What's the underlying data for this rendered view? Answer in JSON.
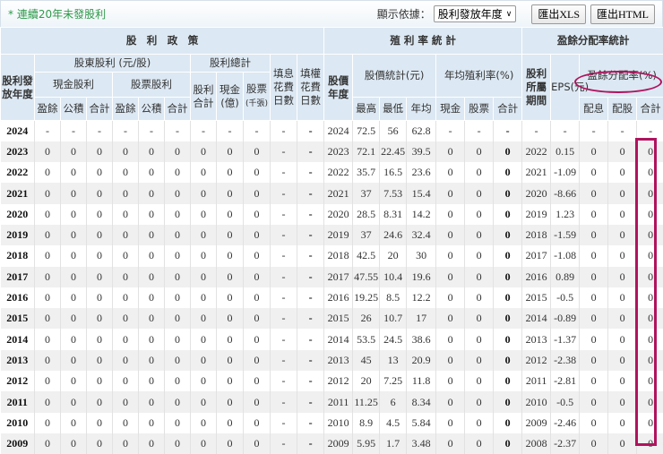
{
  "topbar": {
    "note": "* 連續20年未發股利",
    "display_label": "顯示依據：",
    "display_value": "股利發放年度",
    "export_xls": "匯出XLS",
    "export_html": "匯出HTML"
  },
  "headers": {
    "policy": "股　利　政　策",
    "yield_stats": "殖 利 率 統 計",
    "payout_stats": "盈餘分配率統計",
    "div_year": "股利發放年度",
    "shareholder_div": "股東股利 (元/股)",
    "div_total": "股利總計",
    "fill_div": "填息花費日數",
    "fill_right": "填權花費日數",
    "cash_div": "現金股利",
    "stock_div": "股票股利",
    "earn": "盈餘",
    "reserve": "公積",
    "sum": "合計",
    "div_sum": "股利合計",
    "cash_100m": "現金(億)",
    "stock_k": "股票",
    "stock_k_unit": "(千張)",
    "price_year": "股價年度",
    "price_stats": "股價統計(元)",
    "avg_yield": "年均殖利率(%)",
    "high": "最高",
    "low": "最低",
    "avg": "年均",
    "cash": "現金",
    "stock": "股票",
    "period": "股利所屬期間",
    "eps": "EPS(元)",
    "payout": "盈餘分配率(%)",
    "p_cash": "配息",
    "p_stock": "配股"
  },
  "rows": [
    [
      "2024",
      "-",
      "-",
      "-",
      "-",
      "-",
      "-",
      "-",
      "-",
      "-",
      "-",
      "-",
      "2024",
      "72.5",
      "56",
      "62.8",
      "-",
      "-",
      "-",
      "-",
      "-",
      "-",
      "-",
      "-"
    ],
    [
      "2023",
      "0",
      "0",
      "0",
      "0",
      "0",
      "0",
      "0",
      "0",
      "0",
      "-",
      "-",
      "2023",
      "72.1",
      "22.45",
      "39.5",
      "0",
      "0",
      "0",
      "2022",
      "0.15",
      "0",
      "0",
      "0"
    ],
    [
      "2022",
      "0",
      "0",
      "0",
      "0",
      "0",
      "0",
      "0",
      "0",
      "0",
      "-",
      "-",
      "2022",
      "35.7",
      "16.5",
      "23.6",
      "0",
      "0",
      "0",
      "2021",
      "-1.09",
      "0",
      "0",
      "0"
    ],
    [
      "2021",
      "0",
      "0",
      "0",
      "0",
      "0",
      "0",
      "0",
      "0",
      "0",
      "-",
      "-",
      "2021",
      "37",
      "7.53",
      "15.4",
      "0",
      "0",
      "0",
      "2020",
      "-8.66",
      "0",
      "0",
      "0"
    ],
    [
      "2020",
      "0",
      "0",
      "0",
      "0",
      "0",
      "0",
      "0",
      "0",
      "0",
      "-",
      "-",
      "2020",
      "28.5",
      "8.31",
      "14.2",
      "0",
      "0",
      "0",
      "2019",
      "1.23",
      "0",
      "0",
      "0"
    ],
    [
      "2019",
      "0",
      "0",
      "0",
      "0",
      "0",
      "0",
      "0",
      "0",
      "0",
      "-",
      "-",
      "2019",
      "37",
      "24.6",
      "32.4",
      "0",
      "0",
      "0",
      "2018",
      "-1.59",
      "0",
      "0",
      "0"
    ],
    [
      "2018",
      "0",
      "0",
      "0",
      "0",
      "0",
      "0",
      "0",
      "0",
      "0",
      "-",
      "-",
      "2018",
      "42.5",
      "20",
      "30",
      "0",
      "0",
      "0",
      "2017",
      "-1.08",
      "0",
      "0",
      "0"
    ],
    [
      "2017",
      "0",
      "0",
      "0",
      "0",
      "0",
      "0",
      "0",
      "0",
      "0",
      "-",
      "-",
      "2017",
      "47.55",
      "10.4",
      "19.6",
      "0",
      "0",
      "0",
      "2016",
      "0.89",
      "0",
      "0",
      "0"
    ],
    [
      "2016",
      "0",
      "0",
      "0",
      "0",
      "0",
      "0",
      "0",
      "0",
      "0",
      "-",
      "-",
      "2016",
      "19.25",
      "8.5",
      "12.2",
      "0",
      "0",
      "0",
      "2015",
      "-0.5",
      "0",
      "0",
      "0"
    ],
    [
      "2015",
      "0",
      "0",
      "0",
      "0",
      "0",
      "0",
      "0",
      "0",
      "0",
      "-",
      "-",
      "2015",
      "26",
      "10.7",
      "17",
      "0",
      "0",
      "0",
      "2014",
      "-0.89",
      "0",
      "0",
      "0"
    ],
    [
      "2014",
      "0",
      "0",
      "0",
      "0",
      "0",
      "0",
      "0",
      "0",
      "0",
      "-",
      "-",
      "2014",
      "53.5",
      "24.5",
      "38.6",
      "0",
      "0",
      "0",
      "2013",
      "-1.37",
      "0",
      "0",
      "0"
    ],
    [
      "2013",
      "0",
      "0",
      "0",
      "0",
      "0",
      "0",
      "0",
      "0",
      "0",
      "-",
      "-",
      "2013",
      "45",
      "13",
      "20.9",
      "0",
      "0",
      "0",
      "2012",
      "-2.38",
      "0",
      "0",
      "0"
    ],
    [
      "2012",
      "0",
      "0",
      "0",
      "0",
      "0",
      "0",
      "0",
      "0",
      "0",
      "-",
      "-",
      "2012",
      "20",
      "7.25",
      "11.8",
      "0",
      "0",
      "0",
      "2011",
      "-2.81",
      "0",
      "0",
      "0"
    ],
    [
      "2011",
      "0",
      "0",
      "0",
      "0",
      "0",
      "0",
      "0",
      "0",
      "0",
      "-",
      "-",
      "2011",
      "11.25",
      "6",
      "8.34",
      "0",
      "0",
      "0",
      "2010",
      "-0.5",
      "0",
      "0",
      "0"
    ],
    [
      "2010",
      "0",
      "0",
      "0",
      "0",
      "0",
      "0",
      "0",
      "0",
      "0",
      "-",
      "-",
      "2010",
      "8.9",
      "4.5",
      "5.84",
      "0",
      "0",
      "0",
      "2009",
      "-2.46",
      "0",
      "0",
      "0"
    ],
    [
      "2009",
      "0",
      "0",
      "0",
      "0",
      "0",
      "0",
      "0",
      "0",
      "0",
      "-",
      "-",
      "2009",
      "5.95",
      "1.7",
      "3.48",
      "0",
      "0",
      "0",
      "2008",
      "-2.37",
      "0",
      "0",
      "0"
    ]
  ],
  "colors": {
    "negative": "#2e9a2e",
    "highlight": "#b0135e",
    "header_bg": "#dce8f3"
  }
}
